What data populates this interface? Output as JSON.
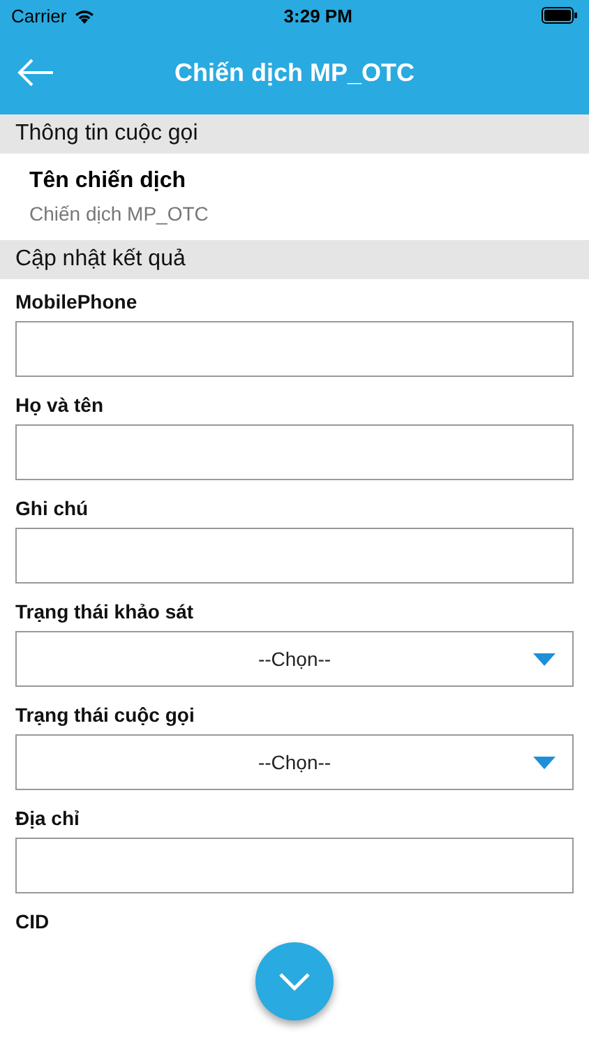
{
  "status_bar": {
    "carrier": "Carrier",
    "time": "3:29 PM"
  },
  "nav": {
    "title": "Chiến dịch MP_OTC"
  },
  "sections": [
    {
      "header": "Thông tin cuộc gọi",
      "info": {
        "label": "Tên chiến dịch",
        "value": "Chiến dịch MP_OTC"
      }
    },
    {
      "header": "Cập nhật kết quả",
      "fields": [
        {
          "label": "MobilePhone",
          "kind": "text"
        },
        {
          "label": "Họ và tên",
          "kind": "text"
        },
        {
          "label": "Ghi chú",
          "kind": "text"
        },
        {
          "label": "Trạng thái khảo sát",
          "kind": "select",
          "value": "--Chọn--"
        },
        {
          "label": "Trạng thái cuộc gọi",
          "kind": "select",
          "value": "--Chọn--"
        },
        {
          "label": "Địa chỉ",
          "kind": "text"
        },
        {
          "label": "CID",
          "kind": "label"
        }
      ]
    }
  ]
}
